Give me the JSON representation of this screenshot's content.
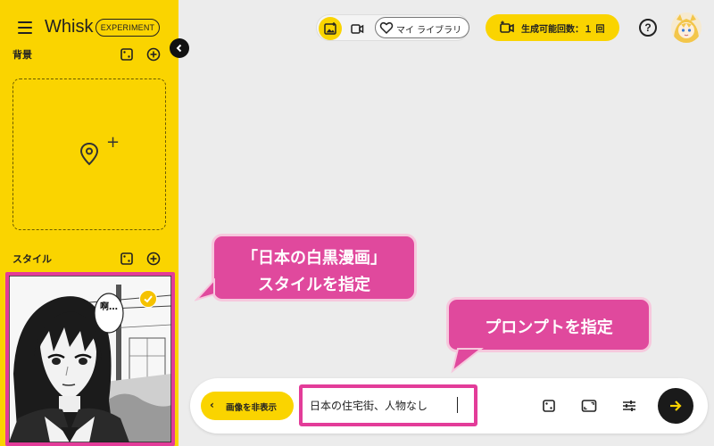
{
  "app": {
    "title": "Whisk",
    "badge": "EXPERIMENT"
  },
  "sidebar": {
    "background_section_title": "背景",
    "style_section_title": "スタイル",
    "style_image_bubble_text": "啊…",
    "style_selected": true
  },
  "topbar": {
    "library_label": "マイ ライブラリ",
    "generation_label": "生成可能回数：１ 回",
    "help_label": "?"
  },
  "callouts": {
    "style_line1": "「日本の白黒漫画」",
    "style_line2": "スタイルを指定",
    "prompt_line1": "プロンプトを指定"
  },
  "prompt_bar": {
    "hide_images_label": "画像を非表示",
    "input_value": "日本の住宅街、人物なし"
  },
  "colors": {
    "accent_yellow": "#fad400",
    "callout_pink": "#e0499d",
    "highlight_border": "#e33c99",
    "send_button": "#1a1a1a"
  },
  "icons": {
    "menu": "hamburger-icon",
    "collapse": "chevron-left-icon",
    "image_mode": "image-icon",
    "video_mode": "video-icon",
    "library": "heart-icon",
    "generation": "video-plus-icon",
    "help": "help-icon",
    "drop_zone": "location-pin-icon",
    "random": "dice-icon",
    "aspect_ratio": "aspect-ratio-icon",
    "settings": "sliders-icon",
    "send": "arrow-right-icon"
  }
}
